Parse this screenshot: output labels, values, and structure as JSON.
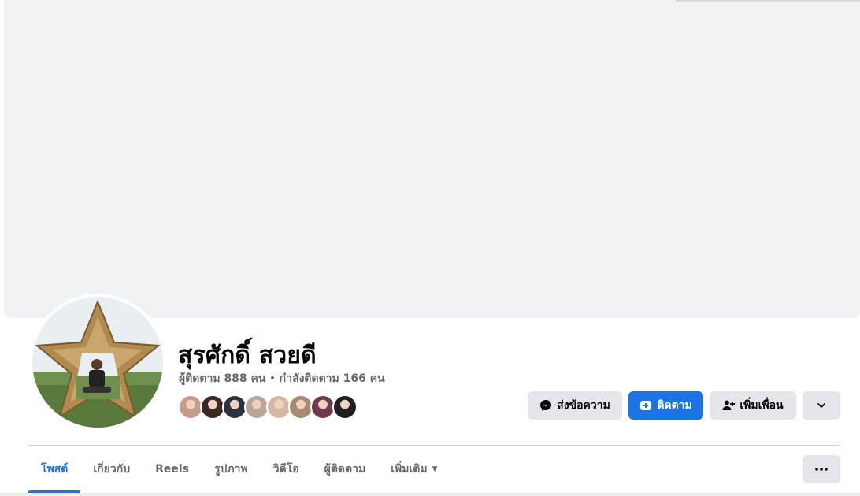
{
  "profile": {
    "name": "สุรศักดิ์ สวยดี",
    "followers_text": "ผู้ติดตาม 888 คน",
    "separator": " • ",
    "following_text": "กำลังติดตาม 166 คน"
  },
  "friends_preview": {
    "colors": [
      "#c79a8a",
      "#3b2a22",
      "#2c3340",
      "#b8a89a",
      "#d7b7a7",
      "#a58b73",
      "#6f3a4c",
      "#1f1f1f"
    ]
  },
  "actions": {
    "message_label": "ส่งข้อความ",
    "follow_label": "ติดตาม",
    "add_friend_label": "เพิ่มเพื่อน"
  },
  "tabs": [
    {
      "label": "โพสต์",
      "active": true
    },
    {
      "label": "เกี่ยวกับ"
    },
    {
      "label": "Reels"
    },
    {
      "label": "รูปภาพ"
    },
    {
      "label": "วิดีโอ"
    },
    {
      "label": "ผู้ติดตาม"
    },
    {
      "label": "เพิ่มเติม"
    }
  ],
  "colors": {
    "accent": "#1b74e4",
    "secondary_button": "#e4e6eb",
    "muted_text": "#65676b",
    "cover": "#f0f2f5"
  }
}
